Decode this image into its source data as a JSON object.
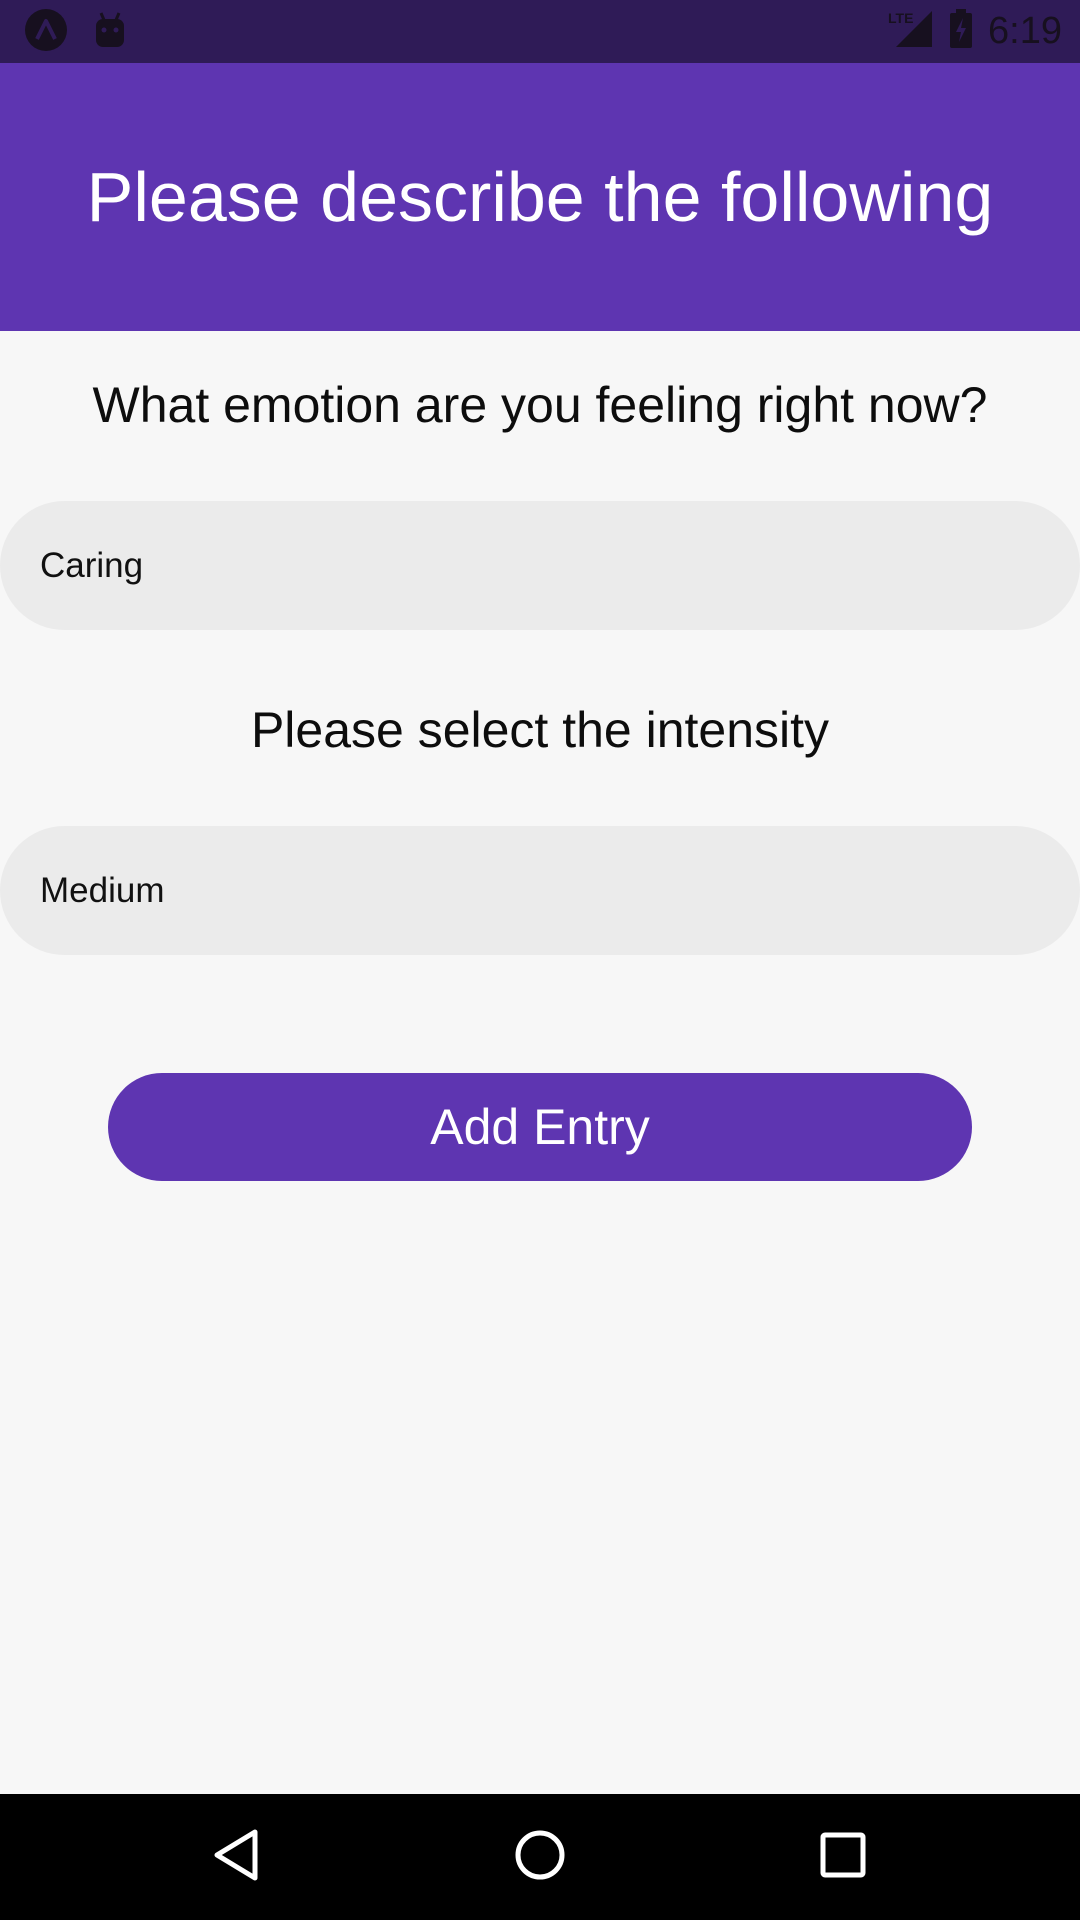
{
  "status_bar": {
    "time": "6:19",
    "network": "LTE",
    "icons": [
      "app-logo-icon",
      "android-debug-icon",
      "cellular-signal-icon",
      "battery-charging-icon"
    ]
  },
  "header": {
    "title": "Please describe the following"
  },
  "form": {
    "emotion_question": "What emotion are you feeling right now?",
    "emotion_value": "Caring",
    "intensity_question": "Please select the intensity",
    "intensity_value": "Medium",
    "submit_label": "Add Entry"
  },
  "nav_bar": {
    "icons": [
      "back-icon",
      "home-icon",
      "recents-icon"
    ]
  },
  "colors": {
    "accent": "#5e35b1",
    "status_bar": "#2f1b57",
    "background": "#f7f7f7",
    "field_background": "#ebebeb",
    "nav_bar": "#000000"
  }
}
